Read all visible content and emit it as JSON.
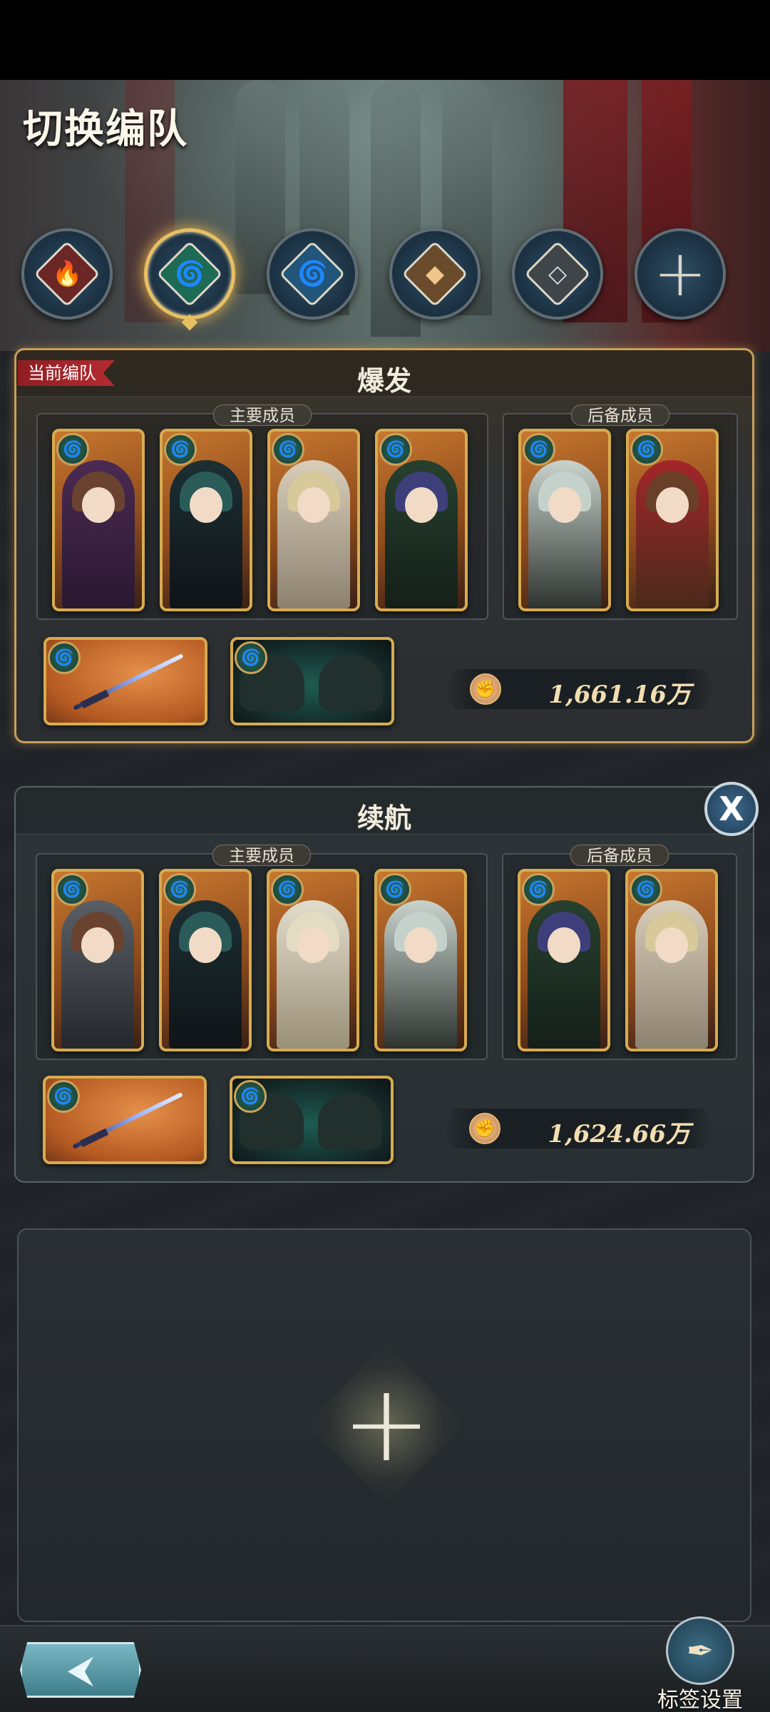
{
  "page": {
    "title": "切换编队"
  },
  "element_tabs": [
    {
      "name": "fire",
      "icon": "fire-icon",
      "glyph": "🔥",
      "color": "#d9473f",
      "active": false
    },
    {
      "name": "wind",
      "icon": "wind-icon",
      "glyph": "🌀",
      "color": "#3fd3a0",
      "active": true
    },
    {
      "name": "water",
      "icon": "water-icon",
      "glyph": "🌀",
      "color": "#4aa6e6",
      "active": false
    },
    {
      "name": "earth",
      "icon": "earth-icon",
      "glyph": "◆",
      "color": "#d4a56a",
      "active": false
    },
    {
      "name": "neutral",
      "icon": "neutral-icon",
      "glyph": "◇",
      "color": "#a9b0b5",
      "active": false
    },
    {
      "name": "add",
      "icon": "plus-icon",
      "glyph": "+",
      "active": false
    }
  ],
  "teams": [
    {
      "name": "爆发",
      "current_badge": "当前编队",
      "main_label": "主要成员",
      "reserve_label": "后备成员",
      "power": "1,661.16万",
      "element_glyph": "🌀"
    },
    {
      "name": "续航",
      "main_label": "主要成员",
      "reserve_label": "后备成员",
      "power": "1,624.66万",
      "element_glyph": "🌀",
      "close_label": "X"
    }
  ],
  "empty_slot": {
    "plus_glyph": "+"
  },
  "bottom": {
    "back_glyph": "⮜",
    "tag_settings_label": "标签设置",
    "tag_settings_glyph": "✒"
  },
  "colors": {
    "accent_gold": "#d7ab50",
    "current_badge_red": "#b52b30",
    "wind_green": "#7ff1c0"
  }
}
